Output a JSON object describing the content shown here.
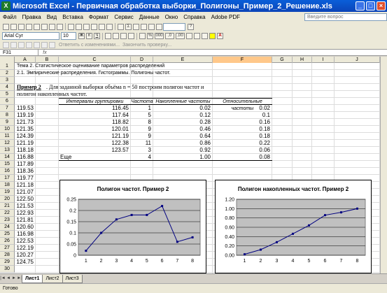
{
  "window": {
    "title": "Microsoft Excel - Первичная обработка выборки_Полигоны_Пример_2_Решение.xls"
  },
  "menu": [
    "Файл",
    "Правка",
    "Вид",
    "Вставка",
    "Формат",
    "Сервис",
    "Данные",
    "Окно",
    "Справка",
    "Adobe PDF"
  ],
  "help_placeholder": "Введите вопрос",
  "toolbar": {
    "font": "Arial Cyr",
    "size": "10",
    "bold": "Ж",
    "italic": "К",
    "underline": "Ч",
    "percent": "%",
    "thousands": "000",
    "inc_dec": ",0",
    "dec_dec": ",00"
  },
  "review_toolbar": {
    "reply": "Ответить с изменениями...",
    "end_review": "Закончить проверку..."
  },
  "formula": {
    "name_box": "F31",
    "fx": "fx",
    "content": ""
  },
  "columns": [
    "A",
    "B",
    "C",
    "D",
    "E",
    "F",
    "G",
    "H",
    "I",
    "J"
  ],
  "selected_column": "F",
  "rows": [
    "1",
    "2",
    "3",
    "4",
    "5",
    "6",
    "7",
    "8",
    "9",
    "10",
    "11",
    "12",
    "13",
    "14",
    "15",
    "16",
    "17",
    "18",
    "19",
    "20",
    "21",
    "22",
    "23",
    "24",
    "25",
    "26",
    "27",
    "28",
    "29",
    "30"
  ],
  "cells": {
    "r1": "Тема 2. Статистическое оценивание параметров распределений",
    "r2": "2.1. Эмпирические распределения. Гистограммы. Полигоны частот.",
    "r4_bold": "Пример 2",
    "r4_rest": ". Для заданной выборки объёма n = 50 построим полигон частот и",
    "r5": "полигон накопленных частот."
  },
  "table": {
    "headers": [
      "Интервалы группировки",
      "Частота",
      "Накопленные частоты",
      "Относительные частоты"
    ],
    "rows": [
      [
        "116.45",
        "1",
        "0.02",
        "0.02"
      ],
      [
        "117.64",
        "5",
        "0.12",
        "0.1"
      ],
      [
        "118.82",
        "8",
        "0.28",
        "0.16"
      ],
      [
        "120.01",
        "9",
        "0.46",
        "0.18"
      ],
      [
        "121.19",
        "9",
        "0.64",
        "0.18"
      ],
      [
        "122.38",
        "11",
        "0.86",
        "0.22"
      ],
      [
        "123.57",
        "3",
        "0.92",
        "0.06"
      ],
      [
        "Еще",
        "4",
        "1.00",
        "0.08"
      ]
    ]
  },
  "column_a": [
    "119.53",
    "119.19",
    "121.73",
    "121.35",
    "124.39",
    "121.19",
    "118.18",
    "116.88",
    "117.89",
    "118.36",
    "119.77",
    "121.18",
    "121.07",
    "122.50",
    "121.53",
    "122.93",
    "121.81",
    "120.60",
    "116.98",
    "122.53",
    "122.19",
    "120.27",
    "124.75"
  ],
  "chart_data": [
    {
      "type": "line",
      "title": "Полигон частот. Пример 2",
      "x": [
        1,
        2,
        3,
        4,
        5,
        6,
        7,
        8
      ],
      "values": [
        0.02,
        0.1,
        0.16,
        0.18,
        0.18,
        0.22,
        0.06,
        0.08
      ],
      "ylim": [
        0,
        0.25
      ],
      "yticks": [
        "0",
        "0.05",
        "0.1",
        "0.15",
        "0.2",
        "0.25"
      ],
      "xticks": [
        "1",
        "2",
        "3",
        "4",
        "5",
        "6",
        "7",
        "8"
      ],
      "color": "#000080",
      "plot_bg": "#c0c0c0",
      "grid": true
    },
    {
      "type": "line",
      "title": "Полигон накопленных частот. Пример 2",
      "x": [
        1,
        2,
        3,
        4,
        5,
        6,
        7,
        8
      ],
      "values": [
        0.02,
        0.12,
        0.28,
        0.46,
        0.64,
        0.86,
        0.92,
        1.0
      ],
      "ylim": [
        0,
        1.2
      ],
      "yticks": [
        "0.00",
        "0.20",
        "0.40",
        "0.60",
        "0.80",
        "1.00",
        "1.20"
      ],
      "xticks": [
        "1",
        "2",
        "3",
        "4",
        "5",
        "6",
        "7",
        "8"
      ],
      "color": "#000080",
      "plot_bg": "#c0c0c0",
      "grid": true
    }
  ],
  "sheets": [
    "Лист1",
    "Лист2",
    "Лист3"
  ],
  "active_sheet": "Лист1",
  "status": "Готово"
}
